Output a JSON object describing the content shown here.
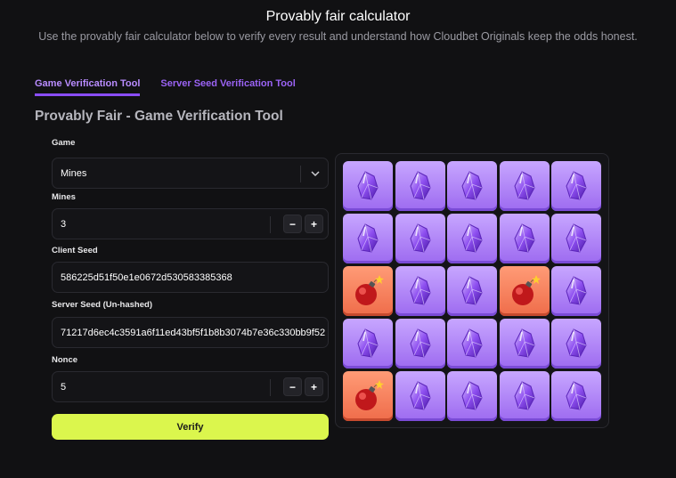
{
  "header": {
    "title": "Provably fair calculator",
    "subtitle": "Use the provably fair calculator below to verify every result and understand how Cloudbet Originals keep the odds honest."
  },
  "tabs": [
    {
      "label": "Game Verification Tool",
      "active": true
    },
    {
      "label": "Server Seed Verification Tool",
      "active": false
    }
  ],
  "section_title": "Provably Fair - Game Verification Tool",
  "form": {
    "game": {
      "label": "Game",
      "value": "Mines"
    },
    "mines": {
      "label": "Mines",
      "value": "3"
    },
    "client_seed": {
      "label": "Client Seed",
      "value": "586225d51f50e1e0672d530583385368"
    },
    "server_seed": {
      "label": "Server Seed (Un-hashed)",
      "value": "71217d6ec4c3591a6f11ed43bf5f1b8b3074b7e36c330bb9f52"
    },
    "nonce": {
      "label": "Nonce",
      "value": "5"
    },
    "minus_label": "−",
    "plus_label": "+",
    "verify_label": "Verify"
  },
  "board": {
    "rows": [
      [
        "gem",
        "gem",
        "gem",
        "gem",
        "gem"
      ],
      [
        "gem",
        "gem",
        "gem",
        "gem",
        "gem"
      ],
      [
        "mine",
        "gem",
        "gem",
        "mine",
        "gem"
      ],
      [
        "gem",
        "gem",
        "gem",
        "gem",
        "gem"
      ],
      [
        "mine",
        "gem",
        "gem",
        "gem",
        "gem"
      ]
    ]
  },
  "colors": {
    "accent_purple": "#8a4dff",
    "verify_button": "#dbf64d",
    "gem_tile": "#b48cfa",
    "mine_tile": "#f47c58"
  }
}
